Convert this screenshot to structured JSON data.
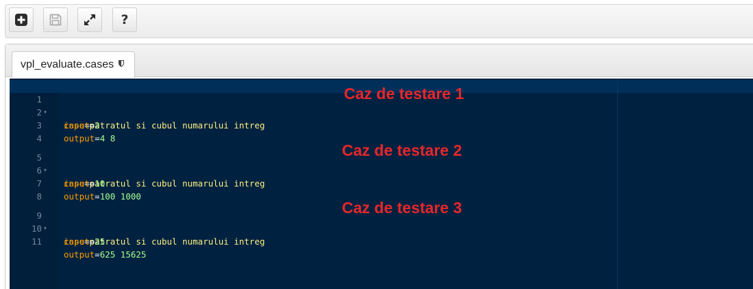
{
  "toolbar": {
    "buttons": [
      {
        "name": "add-button",
        "icon": "plus-square-icon"
      },
      {
        "name": "save-button",
        "icon": "floppy-disk-icon"
      },
      {
        "name": "fullscreen-button",
        "icon": "expand-arrows-icon"
      },
      {
        "name": "help-button",
        "icon": "question-mark-icon",
        "label": "?"
      }
    ]
  },
  "tab": {
    "label": "vpl_evaluate.cases",
    "icon": "shield-icon"
  },
  "editor": {
    "lines": [
      {
        "number": "1",
        "fold": "▾",
        "key": "case",
        "value": "patratul si cubul numarului intreg",
        "type": "case"
      },
      {
        "number": "2",
        "fold": "",
        "key": "input",
        "value": "2",
        "type": "num"
      },
      {
        "number": "3",
        "fold": "",
        "key": "output",
        "value": "4 8",
        "type": "num"
      },
      {
        "number": "4",
        "fold": "",
        "key": "",
        "value": "",
        "type": "empty"
      },
      {
        "number": "5",
        "fold": "▾",
        "key": "case",
        "value": "patratul si cubul numarului intreg",
        "type": "case"
      },
      {
        "number": "6",
        "fold": "",
        "key": "input",
        "value": "10",
        "type": "num"
      },
      {
        "number": "7",
        "fold": "",
        "key": "output",
        "value": "100 1000",
        "type": "num"
      },
      {
        "number": "8",
        "fold": "",
        "key": "",
        "value": "",
        "type": "empty"
      },
      {
        "number": "9",
        "fold": "▾",
        "key": "case",
        "value": "patratul si cubul numarului intreg",
        "type": "case"
      },
      {
        "number": "10",
        "fold": "",
        "key": "input",
        "value": "25",
        "type": "num"
      },
      {
        "number": "11",
        "fold": "",
        "key": "output",
        "value": "625 15625",
        "type": "num"
      }
    ],
    "annotations": [
      "Caz de testare 1",
      "Caz de testare 2",
      "Caz de testare 3"
    ]
  },
  "colors": {
    "editor_bg": "#002240",
    "gutter_bg": "#011e3a",
    "annotation": "#e8262a",
    "key": "#ff9d00",
    "case_value": "#ffee80",
    "num_value": "#a5ff90"
  }
}
